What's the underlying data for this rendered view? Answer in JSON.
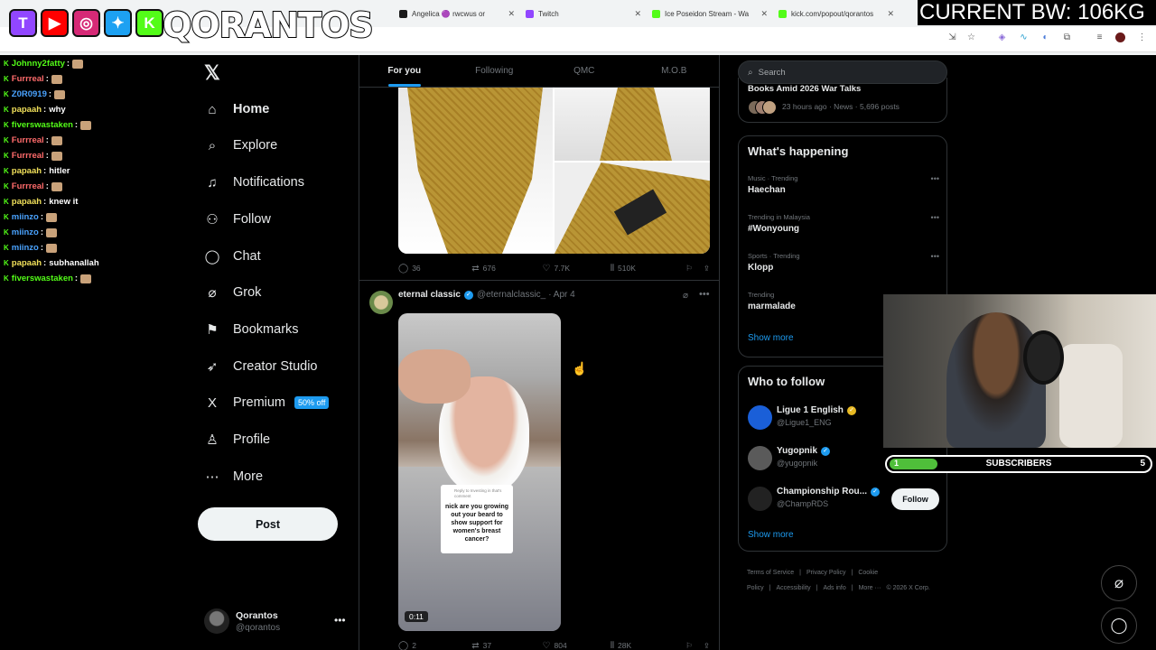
{
  "browser": {
    "tabs": [
      {
        "label": "Angelica 🟣 rwcwus or",
        "color": "#1a1a1a"
      },
      {
        "label": "Twitch",
        "color": "#9146ff"
      },
      {
        "label": "Ice Poseidon Stream - Wa",
        "color": "#53fc18"
      },
      {
        "label": "kick.com/popout/qorantos",
        "color": "#53fc18"
      }
    ]
  },
  "overlay": {
    "streamer_name": "QORANTOS",
    "bandwidth": "CURRENT BW: 106KG",
    "socials": [
      {
        "icon": "twitch-icon",
        "glyph": "T",
        "color": "#9146ff"
      },
      {
        "icon": "youtube-icon",
        "glyph": "▶",
        "color": "#ff0000"
      },
      {
        "icon": "instagram-icon",
        "glyph": "◎",
        "color": "#d62976"
      },
      {
        "icon": "twitter-icon",
        "glyph": "✦",
        "color": "#1da1f2"
      },
      {
        "icon": "kick-icon",
        "glyph": "K",
        "color": "#53fc18"
      }
    ],
    "subscribers": {
      "label": "SUBSCRIBERS",
      "current": "1",
      "goal": "5",
      "progress": 0.18
    }
  },
  "chat": [
    {
      "user": "Johnny2fatty",
      "text": "",
      "color": "#53fc18",
      "emote": true
    },
    {
      "user": "Furrreal",
      "text": "",
      "color": "#ff6b6b",
      "emote": true
    },
    {
      "user": "Z0R0919",
      "text": "",
      "color": "#4aa3ff",
      "emote": true
    },
    {
      "user": "papaah",
      "text": "why",
      "color": "#f1e05a",
      "emote": false
    },
    {
      "user": "fiverswastaken",
      "text": "",
      "color": "#53fc18",
      "emote": true
    },
    {
      "user": "Furrreal",
      "text": "",
      "color": "#ff6b6b",
      "emote": true
    },
    {
      "user": "Furrreal",
      "text": "",
      "color": "#ff6b6b",
      "emote": true
    },
    {
      "user": "papaah",
      "text": "hitler",
      "color": "#f1e05a",
      "emote": false
    },
    {
      "user": "Furrreal",
      "text": "",
      "color": "#ff6b6b",
      "emote": true
    },
    {
      "user": "papaah",
      "text": "knew it",
      "color": "#f1e05a",
      "emote": false
    },
    {
      "user": "miinzo",
      "text": "",
      "color": "#4aa3ff",
      "emote": true
    },
    {
      "user": "miinzo",
      "text": "",
      "color": "#4aa3ff",
      "emote": true
    },
    {
      "user": "miinzo",
      "text": "",
      "color": "#4aa3ff",
      "emote": true
    },
    {
      "user": "papaah",
      "text": "subhanallah",
      "color": "#f1e05a",
      "emote": false
    },
    {
      "user": "fiverswastaken",
      "text": "",
      "color": "#53fc18",
      "emote": true
    }
  ],
  "nav": {
    "items": [
      {
        "name": "home",
        "label": "Home",
        "icon": "⌂"
      },
      {
        "name": "explore",
        "label": "Explore",
        "icon": "⌕"
      },
      {
        "name": "notifications",
        "label": "Notifications",
        "icon": "♫"
      },
      {
        "name": "follow",
        "label": "Follow",
        "icon": "⚇"
      },
      {
        "name": "chat",
        "label": "Chat",
        "icon": "◯"
      },
      {
        "name": "grok",
        "label": "Grok",
        "icon": "⌀"
      },
      {
        "name": "bookmarks",
        "label": "Bookmarks",
        "icon": "⚑"
      },
      {
        "name": "creator-studio",
        "label": "Creator Studio",
        "icon": "➶"
      },
      {
        "name": "premium",
        "label": "Premium",
        "icon": "X"
      },
      {
        "name": "profile",
        "label": "Profile",
        "icon": "♙"
      },
      {
        "name": "more",
        "label": "More",
        "icon": "⋯"
      }
    ],
    "premium_badge": "50% off",
    "post_label": "Post",
    "account": {
      "name": "Qorantos",
      "handle": "@qorantos"
    }
  },
  "timeline": {
    "tabs": [
      "For you",
      "Following",
      "QMC",
      "M.O.B"
    ],
    "tweet1": {
      "replies": "36",
      "reposts": "676",
      "likes": "7.7K",
      "views": "510K"
    },
    "tweet2": {
      "name": "eternal classic",
      "handle": "@eternalclassic_",
      "date": "· Apr 4",
      "caption_header": "Reply to Investing in that's comment",
      "caption": "nick are you growing out your beard to show support for women's breast cancer?",
      "duration": "0:11",
      "replies": "2",
      "reposts": "37",
      "likes": "804",
      "views": "28K"
    }
  },
  "sidebar": {
    "search_placeholder": "Search",
    "news": {
      "title": "Books Amid 2026 War Talks",
      "meta": "23 hours ago · News · 5,696 posts"
    },
    "happening_title": "What's happening",
    "trends": [
      {
        "meta": "Music · Trending",
        "name": "Haechan"
      },
      {
        "meta": "Trending in Malaysia",
        "name": "#Wonyoung"
      },
      {
        "meta": "Sports · Trending",
        "name": "Klopp"
      },
      {
        "meta": "Trending",
        "name": "marmalade"
      }
    ],
    "show_more": "Show more",
    "who_to_follow_title": "Who to follow",
    "follow_suggestions": [
      {
        "name": "Ligue 1 English",
        "handle": "@Ligue1_ENG",
        "color": "#1a5fd8"
      },
      {
        "name": "Yugopnik",
        "handle": "@yugopnik",
        "color": "#5a5a5a"
      },
      {
        "name": "Championship Rou...",
        "handle": "@ChampRDS",
        "color": "#222"
      }
    ],
    "follow_button": "Follow",
    "footer": [
      "Terms of Service",
      "|",
      "Privacy Policy",
      "|",
      "Cookie Policy",
      "|",
      "Accessibility",
      "|",
      "Ads info",
      "|",
      "More ···",
      "© 2026 X Corp."
    ]
  }
}
